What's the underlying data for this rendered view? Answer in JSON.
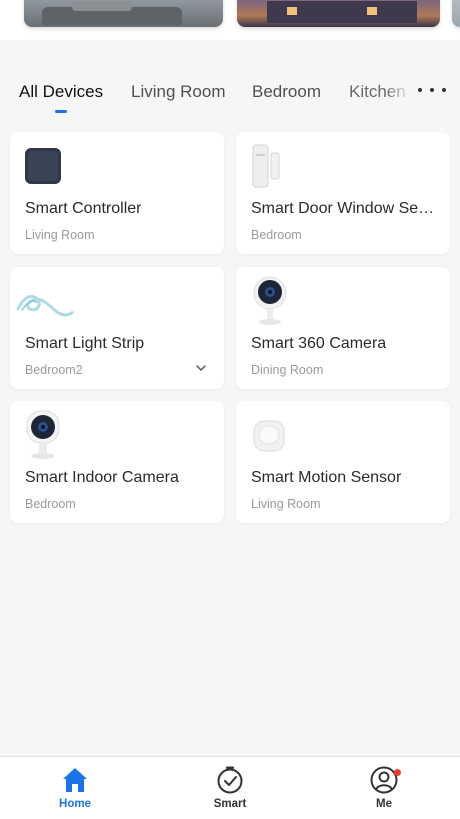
{
  "scenes": [
    {
      "name": "living-room-scene"
    },
    {
      "name": "house-exterior-scene"
    },
    {
      "name": "third-scene"
    }
  ],
  "tabs": [
    {
      "label": "All Devices",
      "active": true
    },
    {
      "label": "Living Room",
      "active": false
    },
    {
      "label": "Bedroom",
      "active": false
    },
    {
      "label": "Kitchen",
      "active": false
    }
  ],
  "more_icon": "more-horizontal-icon",
  "devices": [
    {
      "name": "Smart Controller",
      "room": "Living Room",
      "icon": "controller-icon"
    },
    {
      "name": "Smart Door Window Sensor",
      "room": "Bedroom",
      "icon": "door-sensor-icon"
    },
    {
      "name": "Smart Light Strip",
      "room": "Bedroom2",
      "icon": "light-strip-icon",
      "has_expand": true
    },
    {
      "name": "Smart 360 Camera",
      "room": "Dining Room",
      "icon": "camera-icon"
    },
    {
      "name": "Smart Indoor Camera",
      "room": "Bedroom",
      "icon": "indoor-camera-icon"
    },
    {
      "name": "Smart Motion Sensor",
      "room": "Living Room",
      "icon": "motion-sensor-icon"
    }
  ],
  "bottom_nav": [
    {
      "label": "Home",
      "icon": "home-icon",
      "active": true
    },
    {
      "label": "Smart",
      "icon": "timer-check-icon",
      "active": false
    },
    {
      "label": "Me",
      "icon": "user-icon",
      "active": false,
      "badge": true
    }
  ],
  "colors": {
    "accent": "#1a73e8",
    "background": "#f6f6f6",
    "card": "#ffffff",
    "badge": "#f03a2e"
  }
}
